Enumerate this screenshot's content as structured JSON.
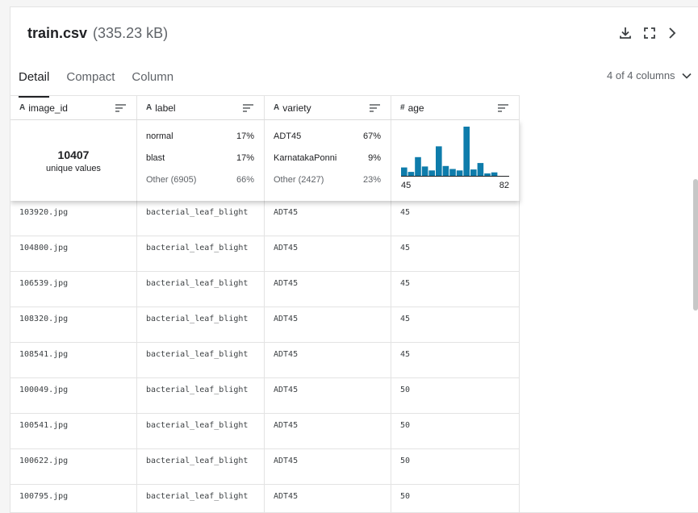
{
  "file": {
    "name": "train.csv",
    "size": "(335.23 kB)"
  },
  "icons": {
    "download": "download-icon",
    "fullscreen": "fullscreen-icon",
    "next": "chevron-right-icon"
  },
  "tabs": [
    {
      "label": "Detail",
      "active": true
    },
    {
      "label": "Compact",
      "active": false
    },
    {
      "label": "Column",
      "active": false
    }
  ],
  "columns_selector": "4 of 4 columns",
  "columns": [
    {
      "name": "image_id",
      "type_icon": "A"
    },
    {
      "name": "label",
      "type_icon": "A"
    },
    {
      "name": "variety",
      "type_icon": "A"
    },
    {
      "name": "age",
      "type_icon": "#"
    }
  ],
  "stats": {
    "image_id": {
      "count": "10407",
      "label": "unique values"
    },
    "label": [
      {
        "name": "normal",
        "pct": "17%"
      },
      {
        "name": "blast",
        "pct": "17%"
      },
      {
        "name": "Other (6905)",
        "pct": "66%"
      }
    ],
    "variety": [
      {
        "name": "ADT45",
        "pct": "67%"
      },
      {
        "name": "KarnatakaPonni",
        "pct": "9%"
      },
      {
        "name": "Other (2427)",
        "pct": "23%"
      }
    ],
    "age": {
      "min": "45",
      "max": "82",
      "bins": [
        0.17,
        0.08,
        0.38,
        0.19,
        0.11,
        0.6,
        0.2,
        0.14,
        0.11,
        1.0,
        0.13,
        0.26,
        0.05,
        0.07
      ]
    }
  },
  "rows": [
    {
      "image_id": "103920.jpg",
      "label": "bacterial_leaf_blight",
      "variety": "ADT45",
      "age": "45"
    },
    {
      "image_id": "104800.jpg",
      "label": "bacterial_leaf_blight",
      "variety": "ADT45",
      "age": "45"
    },
    {
      "image_id": "106539.jpg",
      "label": "bacterial_leaf_blight",
      "variety": "ADT45",
      "age": "45"
    },
    {
      "image_id": "108320.jpg",
      "label": "bacterial_leaf_blight",
      "variety": "ADT45",
      "age": "45"
    },
    {
      "image_id": "108541.jpg",
      "label": "bacterial_leaf_blight",
      "variety": "ADT45",
      "age": "45"
    },
    {
      "image_id": "100049.jpg",
      "label": "bacterial_leaf_blight",
      "variety": "ADT45",
      "age": "50"
    },
    {
      "image_id": "100541.jpg",
      "label": "bacterial_leaf_blight",
      "variety": "ADT45",
      "age": "50"
    },
    {
      "image_id": "100622.jpg",
      "label": "bacterial_leaf_blight",
      "variety": "ADT45",
      "age": "50"
    },
    {
      "image_id": "100795.jpg",
      "label": "bacterial_leaf_blight",
      "variety": "ADT45",
      "age": "50"
    }
  ],
  "colors": {
    "bar": "#0e7cab",
    "border": "#e3e3e3",
    "text": "#202124",
    "muted": "#5f6368"
  }
}
